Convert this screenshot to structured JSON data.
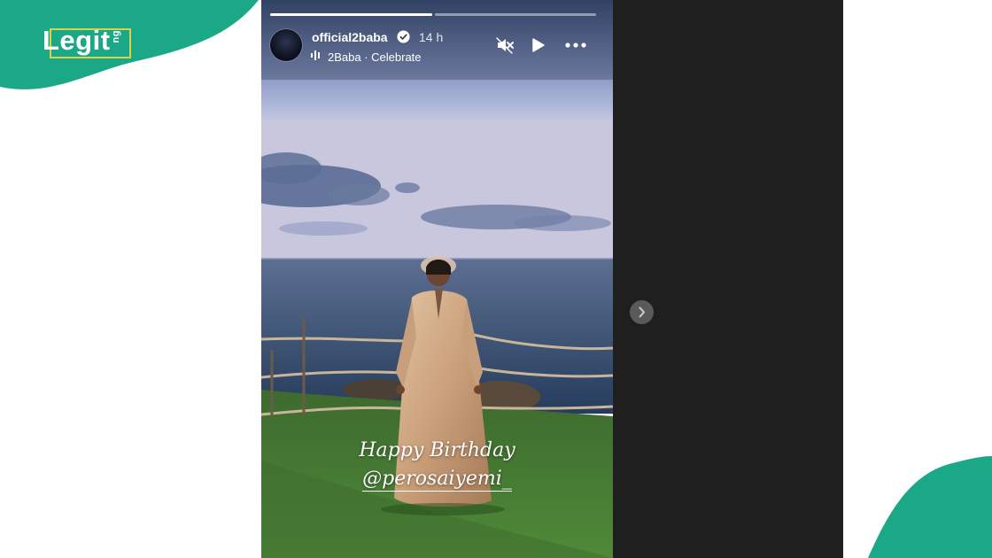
{
  "brand": {
    "logo_word": "Legit",
    "logo_suffix": "ng",
    "color": "#1aa886"
  },
  "story": {
    "username": "official2baba",
    "verified": true,
    "time_ago": "14 h",
    "music": {
      "icon": "music-bars-icon",
      "label": "2Baba · Celebrate"
    },
    "controls": [
      "mute-icon",
      "play-icon",
      "more-options-icon"
    ],
    "progress": [
      {
        "filled": 1.0
      },
      {
        "filled": 0.0
      }
    ],
    "caption_line1": "Happy Birthday",
    "caption_line2": "@perosaiyemi_"
  },
  "navigation": {
    "next_icon": "chevron-right-icon"
  }
}
